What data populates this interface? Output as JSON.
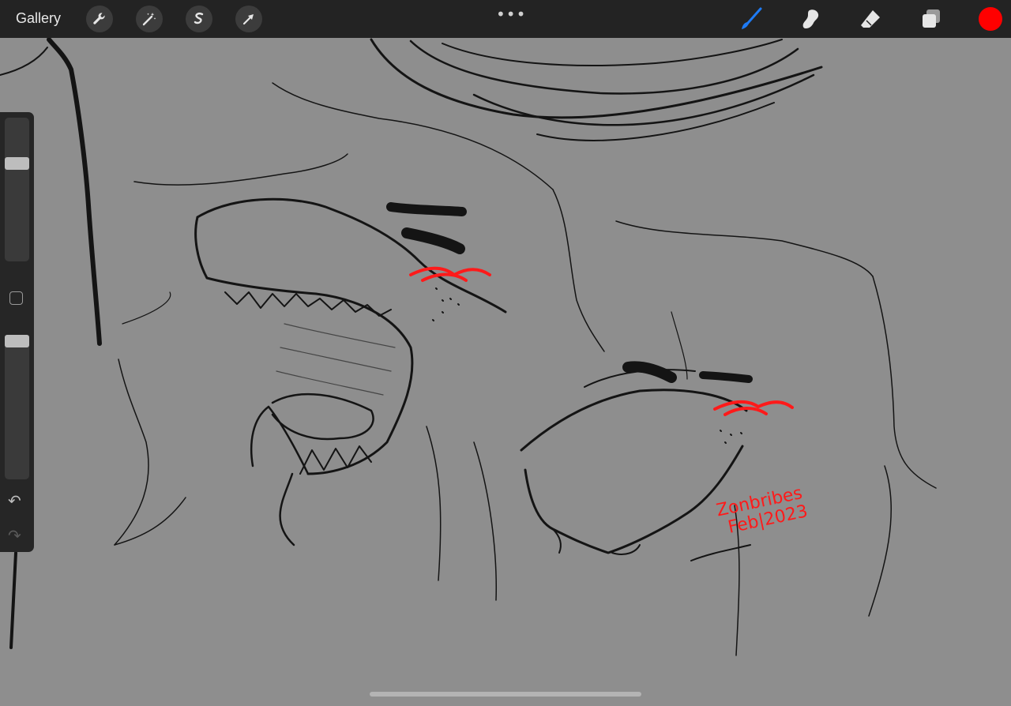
{
  "topbar": {
    "gallery_label": "Gallery",
    "more_glyph": "•••",
    "left_tools": [
      "wrench-icon",
      "magic-wand-icon",
      "selection-icon",
      "arrow-icon"
    ],
    "right_tools": [
      "brush-icon",
      "smudge-icon",
      "eraser-icon",
      "layers-icon"
    ],
    "brush_color": "#1e7bf5",
    "current_color": "#ff0000"
  },
  "sidebar": {
    "brush_size_level": 0.3,
    "opacity_level": 0.05,
    "undo_glyph": "↶",
    "redo_glyph": "↷"
  },
  "artwork": {
    "signature_lines": [
      "Zonbribes",
      "Feb|2023"
    ],
    "line_color": "#111111",
    "blush_color": "#ff1a1a"
  }
}
